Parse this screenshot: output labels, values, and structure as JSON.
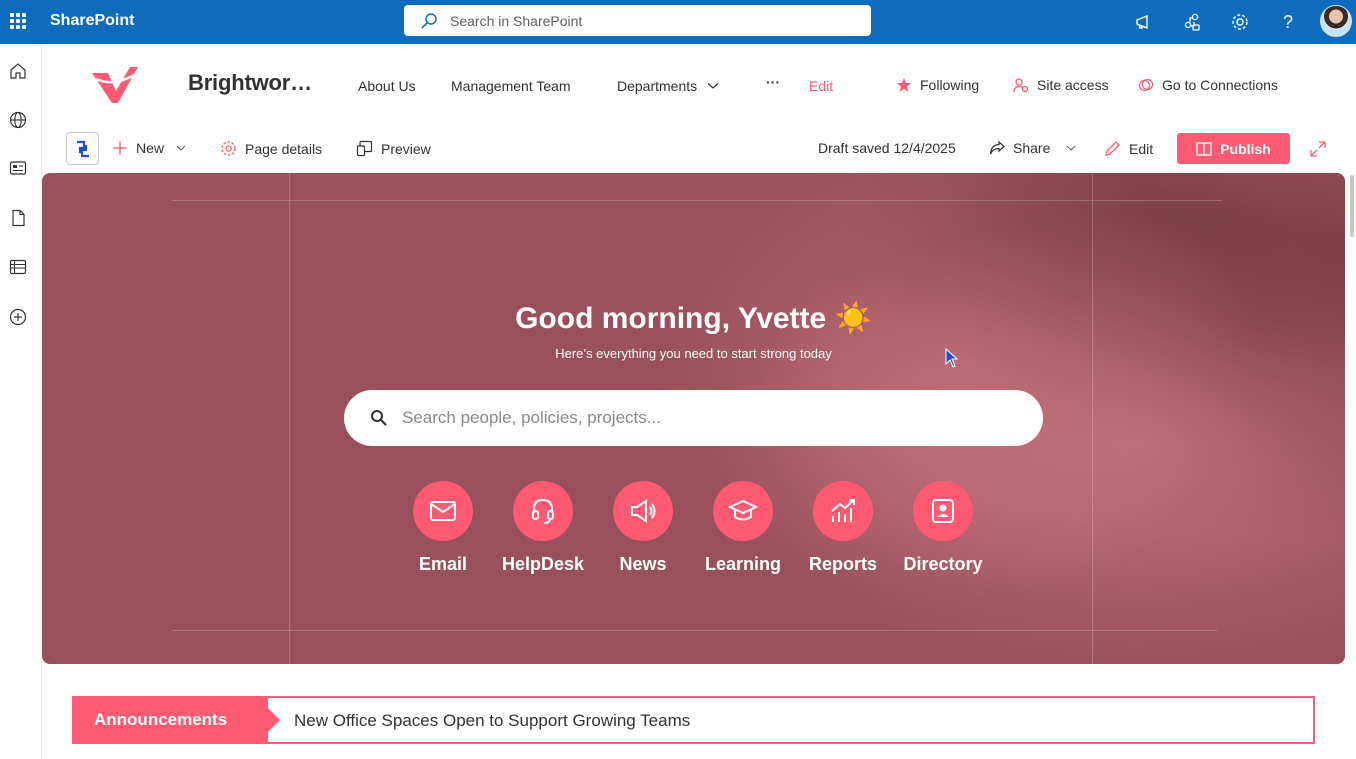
{
  "colors": {
    "suitebar": "#0f6cbd",
    "accent": "#ff5a73",
    "hero_bg": "#98515c"
  },
  "suitebar": {
    "title": "SharePoint",
    "search_placeholder": "Search in SharePoint",
    "icons": [
      "megaphone-icon",
      "connect-icon",
      "gear-icon",
      "help-icon"
    ],
    "help_glyph": "?"
  },
  "leftrail": {
    "icons": [
      "home-icon",
      "globe-icon",
      "news-icon",
      "document-icon",
      "list-icon",
      "add-circle-icon"
    ]
  },
  "site": {
    "title": "Brightwork Corporate Intranet",
    "nav": {
      "about": "About Us",
      "management": "Management Team",
      "departments": "Departments",
      "more": "···",
      "edit": "Edit"
    },
    "actions": {
      "following": "Following",
      "site_access": "Site access",
      "connections": "Go to Connections"
    }
  },
  "commandbar": {
    "new": "New",
    "page_details": "Page details",
    "preview": "Preview",
    "draft_status": "Draft saved 12/4/2025",
    "share": "Share",
    "edit": "Edit",
    "publish": "Publish"
  },
  "hero": {
    "greeting": "Good morning, Yvette ☀️",
    "subtitle": "Here’s everything you need to start strong today",
    "search_placeholder": "Search people, policies, projects...",
    "quick_links": [
      {
        "label": "Email",
        "icon": "mail-icon"
      },
      {
        "label": "HelpDesk",
        "icon": "headset-icon"
      },
      {
        "label": "News",
        "icon": "megaphone-icon"
      },
      {
        "label": "Learning",
        "icon": "graduation-cap-icon"
      },
      {
        "label": "Reports",
        "icon": "chart-icon"
      },
      {
        "label": "Directory",
        "icon": "contact-card-icon"
      }
    ]
  },
  "announcements": {
    "label": "Announcements",
    "headline": "New Office Spaces Open to Support Growing Teams"
  }
}
